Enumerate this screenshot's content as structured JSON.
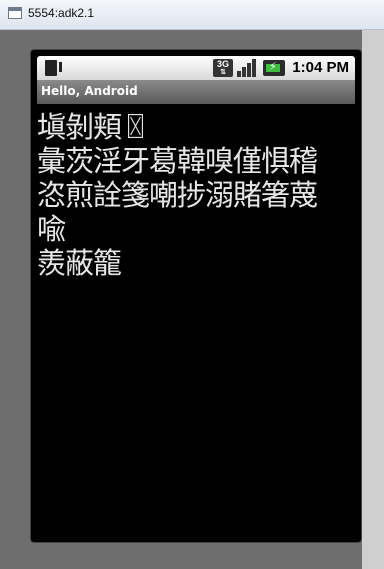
{
  "window": {
    "title": "5554:adk2.1"
  },
  "status_bar": {
    "network_type": "3G",
    "time": "1:04 PM"
  },
  "app": {
    "title": "Hello, Android"
  },
  "content": {
    "lines": [
      "塡剝頬〿",
      "彙茨淫牙葛韓嗅僅惧稽",
      "恣煎詮箋嘲捗溺賭箸蔑",
      "喩",
      "羨蔽籠"
    ]
  },
  "colors": {
    "screen_bg": "#000000",
    "text": "#e6e6e6",
    "battery_fill": "#3fbf3f"
  }
}
